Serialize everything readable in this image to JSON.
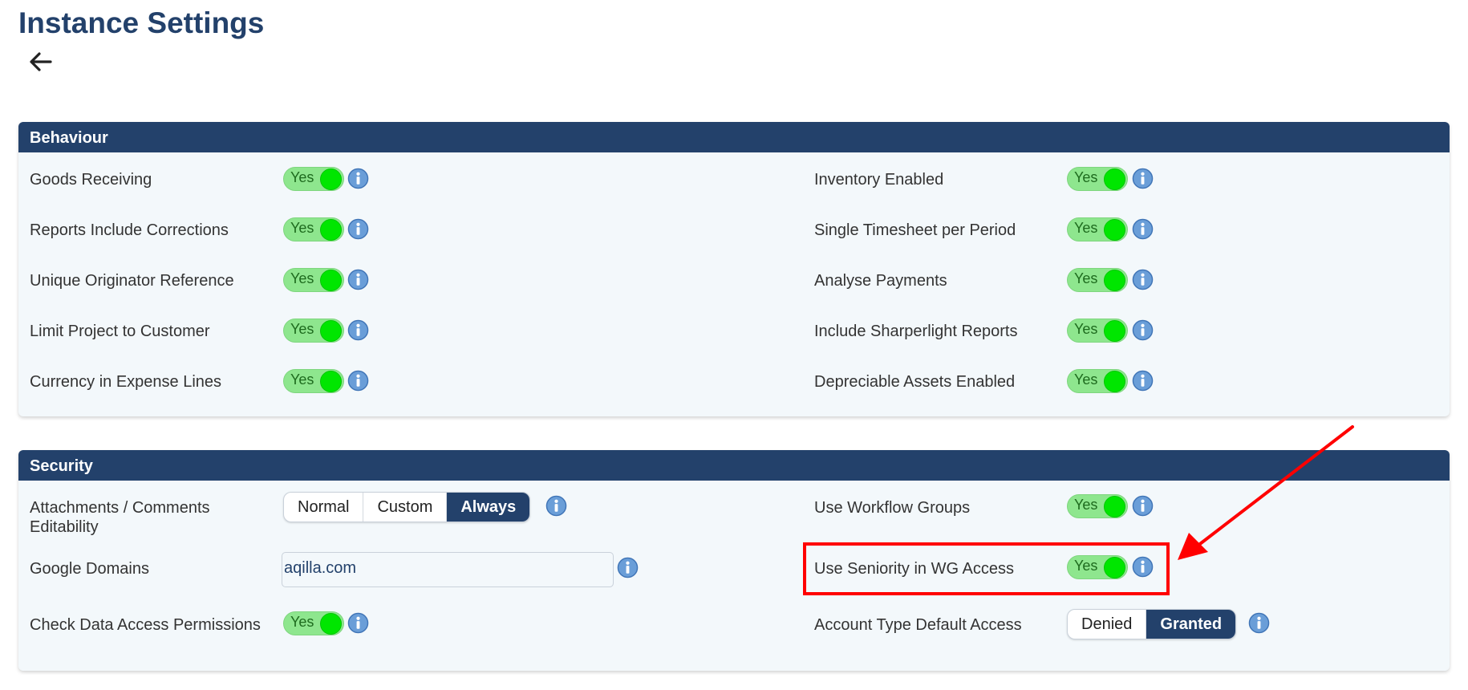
{
  "page": {
    "title": "Instance Settings"
  },
  "behaviour": {
    "title": "Behaviour",
    "left": [
      {
        "label": "Goods Receiving",
        "value": "Yes"
      },
      {
        "label": "Reports Include Corrections",
        "value": "Yes"
      },
      {
        "label": "Unique Originator Reference",
        "value": "Yes"
      },
      {
        "label": "Limit Project to Customer",
        "value": "Yes"
      },
      {
        "label": "Currency in Expense Lines",
        "value": "Yes"
      }
    ],
    "right": [
      {
        "label": "Inventory Enabled",
        "value": "Yes"
      },
      {
        "label": "Single Timesheet per Period",
        "value": "Yes"
      },
      {
        "label": "Analyse Payments",
        "value": "Yes"
      },
      {
        "label": "Include Sharperlight Reports",
        "value": "Yes"
      },
      {
        "label": "Depreciable Assets Enabled",
        "value": "Yes"
      }
    ]
  },
  "security": {
    "title": "Security",
    "attachments": {
      "label": "Attachments / Comments Editability",
      "options": [
        "Normal",
        "Custom",
        "Always"
      ],
      "selected": "Always"
    },
    "google_domains": {
      "label": "Google Domains",
      "value": "aqilla.com"
    },
    "check_data_access": {
      "label": "Check Data Access Permissions",
      "value": "Yes"
    },
    "use_workflow_groups": {
      "label": "Use Workflow Groups",
      "value": "Yes"
    },
    "use_seniority": {
      "label": "Use Seniority in WG Access",
      "value": "Yes"
    },
    "account_type_default": {
      "label": "Account Type Default Access",
      "options": [
        "Denied",
        "Granted"
      ],
      "selected": "Granted"
    }
  },
  "colors": {
    "header_bg": "#23416b",
    "panel_bg": "#f3f8fb",
    "toggle_on": "#8ee68e",
    "toggle_knob": "#00e600",
    "annotation": "#ff0000"
  },
  "icons": {
    "back": "arrow-left-icon",
    "info": "info-icon"
  }
}
